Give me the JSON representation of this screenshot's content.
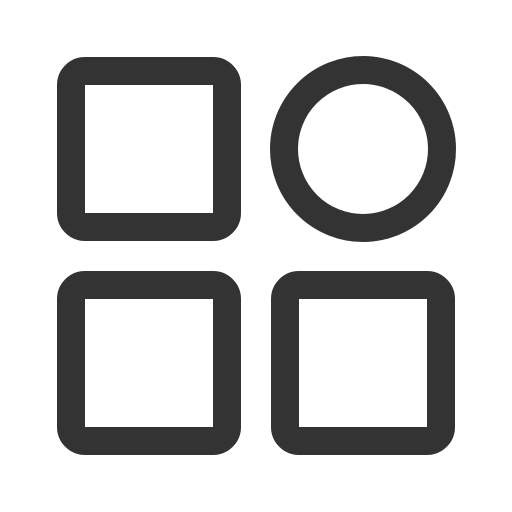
{
  "icon": {
    "name": "apps-grid-icon",
    "stroke_color": "#333333",
    "background_color": "#ffffff",
    "shapes": [
      "square",
      "circle",
      "square",
      "square"
    ]
  }
}
